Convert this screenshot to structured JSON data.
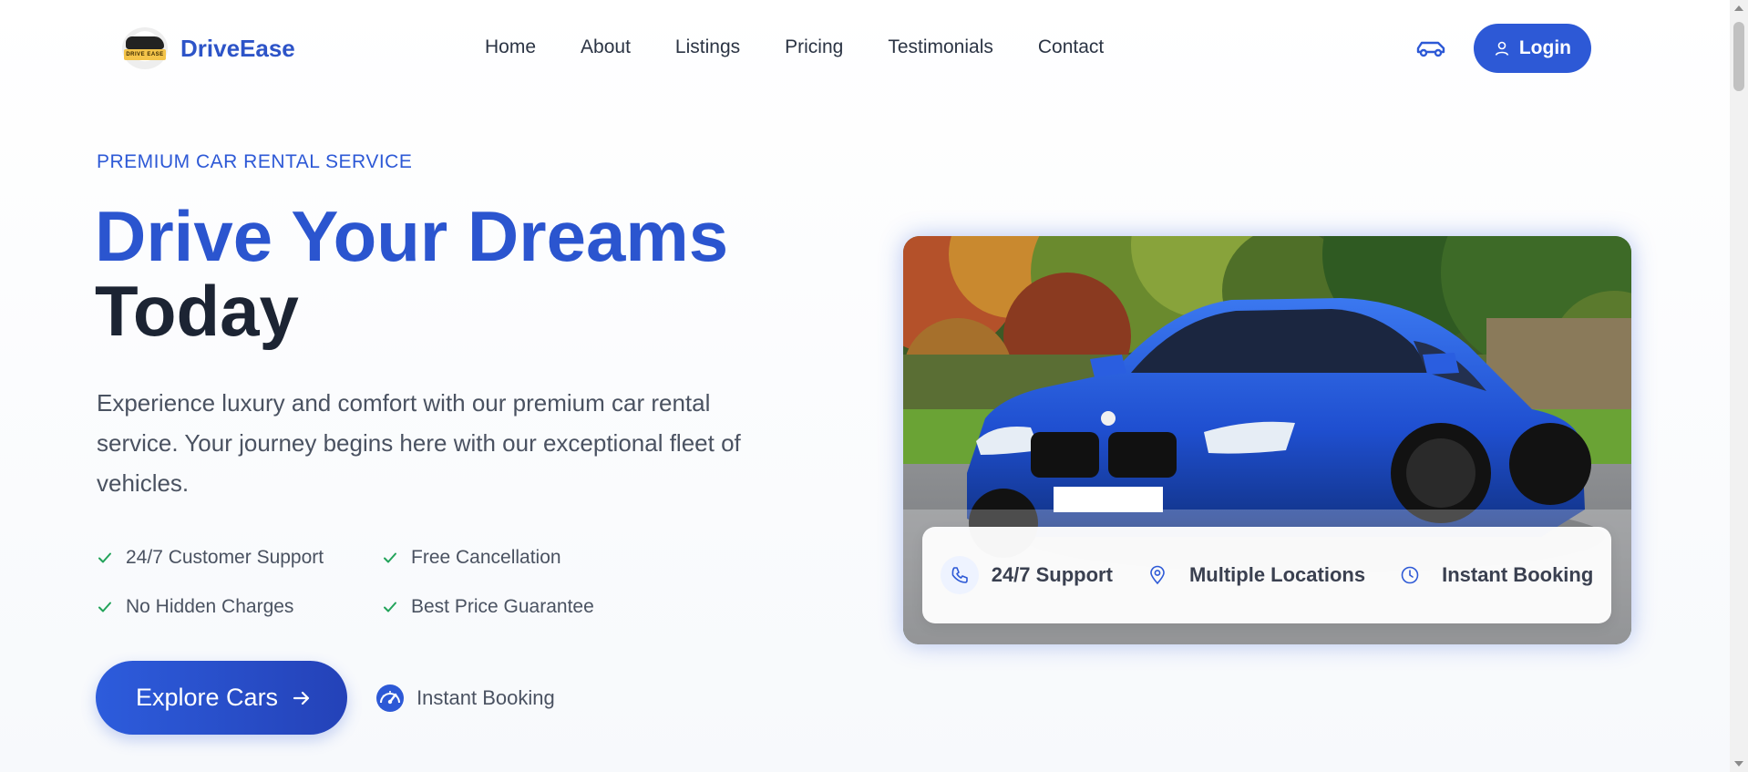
{
  "header": {
    "brand_name": "DriveEase",
    "logo_text": "DRIVE EASE",
    "nav": [
      "Home",
      "About",
      "Listings",
      "Pricing",
      "Testimonials",
      "Contact"
    ],
    "login_label": "Login"
  },
  "hero": {
    "eyebrow": "PREMIUM CAR RENTAL SERVICE",
    "headline_line1": "Drive Your Dreams",
    "headline_line2": "Today",
    "lead": "Experience luxury and comfort with our premium car rental service. Your journey begins here with our exceptional fleet of vehicles.",
    "features": [
      "24/7 Customer Support",
      "Free Cancellation",
      "No Hidden Charges",
      "Best Price Guarantee"
    ],
    "cta_label": "Explore Cars",
    "secondary_label": "Instant Booking"
  },
  "hero_image": {
    "info": [
      {
        "label": "24/7 Support",
        "icon": "phone-icon"
      },
      {
        "label": "Multiple Locations",
        "icon": "map-pin-icon"
      },
      {
        "label": "Instant Booking",
        "icon": "clock-icon"
      }
    ]
  },
  "colors": {
    "primary": "#2d59d6",
    "heading_dark": "#1c2433",
    "check_green": "#22a35a"
  }
}
